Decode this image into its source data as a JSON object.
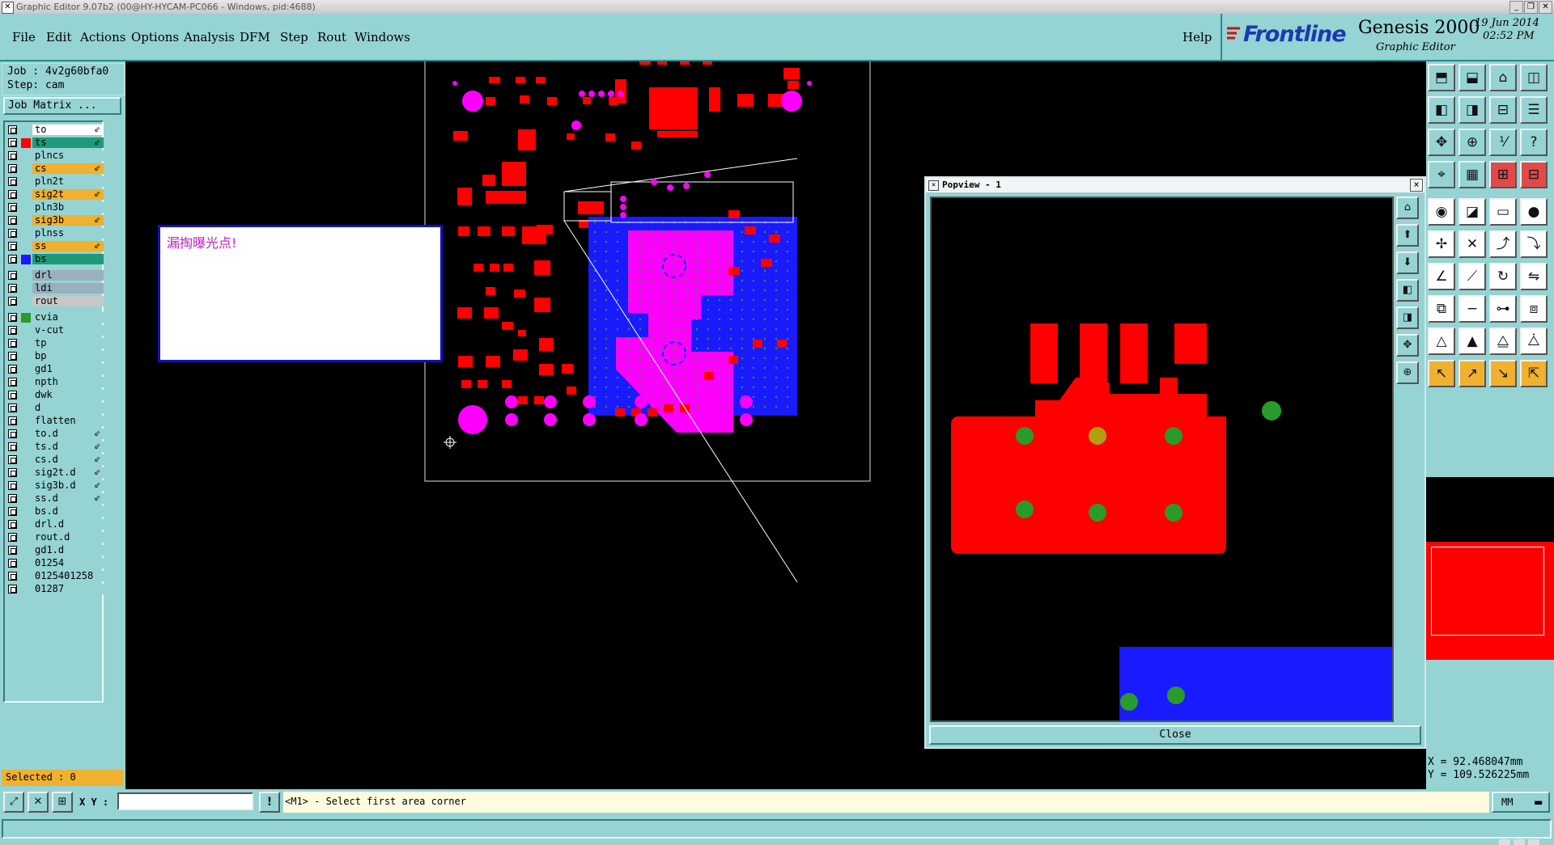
{
  "window": {
    "title": "Graphic Editor 9.07b2 (00@HY-HYCAM-PC066 - Windows, pid:4688)"
  },
  "menu": {
    "items": [
      "File",
      "Edit",
      "Actions",
      "Options",
      "Analysis",
      "DFM",
      "Step",
      "Rout",
      "Windows"
    ],
    "help": "Help"
  },
  "brand": {
    "logo": "Frontline",
    "product": "Genesis 2000",
    "subtitle": "Graphic Editor",
    "date": "19 Jun 2014",
    "time": "02:52 PM"
  },
  "job": {
    "job_line": "Job : 4v2g60bfa0",
    "step_line": "Step: cam",
    "matrix_button": "Job Matrix ..."
  },
  "layers": [
    {
      "name": "to",
      "bg": "#ffffff",
      "swatch": "",
      "mark": "⇙"
    },
    {
      "name": "ts",
      "bg": "#1e9a78",
      "swatch": "#ff0000",
      "mark": "⇙"
    },
    {
      "name": "plncs",
      "bg": "#96d3d3",
      "swatch": "",
      "mark": ""
    },
    {
      "name": "cs",
      "bg": "#f0b030",
      "swatch": "",
      "mark": "⇙"
    },
    {
      "name": "pln2t",
      "bg": "#96d3d3",
      "swatch": "",
      "mark": ""
    },
    {
      "name": "sig2t",
      "bg": "#f0b030",
      "swatch": "",
      "mark": "⇙"
    },
    {
      "name": "pln3b",
      "bg": "#96d3d3",
      "swatch": "",
      "mark": ""
    },
    {
      "name": "sig3b",
      "bg": "#f0b030",
      "swatch": "",
      "mark": "⇙"
    },
    {
      "name": "plnss",
      "bg": "#96d3d3",
      "swatch": "",
      "mark": ""
    },
    {
      "name": "ss",
      "bg": "#f0b030",
      "swatch": "",
      "mark": "⇙"
    },
    {
      "name": "bs",
      "bg": "#1e9a78",
      "swatch": "#1a1aff",
      "mark": ""
    },
    {
      "name": "drl",
      "bg": "#9ab0bc",
      "swatch": "",
      "mark": ""
    },
    {
      "name": "ldi",
      "bg": "#9ab0bc",
      "swatch": "",
      "mark": ""
    },
    {
      "name": "rout",
      "bg": "#c8c8c8",
      "swatch": "",
      "mark": ""
    },
    {
      "name": "cvia",
      "bg": "#96d3d3",
      "swatch": "#2a9a2a",
      "mark": ""
    },
    {
      "name": "v-cut",
      "bg": "#96d3d3",
      "swatch": "",
      "mark": ""
    },
    {
      "name": "tp",
      "bg": "#96d3d3",
      "swatch": "",
      "mark": ""
    },
    {
      "name": "bp",
      "bg": "#96d3d3",
      "swatch": "",
      "mark": ""
    },
    {
      "name": "gd1",
      "bg": "#96d3d3",
      "swatch": "",
      "mark": ""
    },
    {
      "name": "npth",
      "bg": "#96d3d3",
      "swatch": "",
      "mark": ""
    },
    {
      "name": "dwk",
      "bg": "#96d3d3",
      "swatch": "",
      "mark": ""
    },
    {
      "name": "d",
      "bg": "#96d3d3",
      "swatch": "",
      "mark": ""
    },
    {
      "name": "flatten",
      "bg": "#96d3d3",
      "swatch": "",
      "mark": ""
    },
    {
      "name": "to.d",
      "bg": "#96d3d3",
      "swatch": "",
      "mark": "⇙"
    },
    {
      "name": "ts.d",
      "bg": "#96d3d3",
      "swatch": "",
      "mark": "⇙"
    },
    {
      "name": "cs.d",
      "bg": "#96d3d3",
      "swatch": "",
      "mark": "⇙"
    },
    {
      "name": "sig2t.d",
      "bg": "#96d3d3",
      "swatch": "",
      "mark": "⇙"
    },
    {
      "name": "sig3b.d",
      "bg": "#96d3d3",
      "swatch": "",
      "mark": "⇙"
    },
    {
      "name": "ss.d",
      "bg": "#96d3d3",
      "swatch": "",
      "mark": "⇙"
    },
    {
      "name": "bs.d",
      "bg": "#96d3d3",
      "swatch": "",
      "mark": ""
    },
    {
      "name": "drl.d",
      "bg": "#96d3d3",
      "swatch": "",
      "mark": ""
    },
    {
      "name": "rout.d",
      "bg": "#96d3d3",
      "swatch": "",
      "mark": ""
    },
    {
      "name": "gd1.d",
      "bg": "#96d3d3",
      "swatch": "",
      "mark": ""
    },
    {
      "name": "01254",
      "bg": "#96d3d3",
      "swatch": "",
      "mark": ""
    },
    {
      "name": "0125401258",
      "bg": "#96d3d3",
      "swatch": "",
      "mark": ""
    },
    {
      "name": "01287",
      "bg": "#96d3d3",
      "swatch": "",
      "mark": ""
    }
  ],
  "selected": "Selected : 0",
  "message": "漏掏曝光点!",
  "popview": {
    "title": "Popview - 1",
    "close_label": "Close",
    "close_x": "×"
  },
  "coords": {
    "x_line": "X = 92.468047mm",
    "y_line": "Y = 109.526225mm"
  },
  "status": {
    "xy_label": "X Y :",
    "xy_value": "",
    "prompt": "<M1> - Select first area corner",
    "units": "MM"
  },
  "colors": {
    "panel": "#96d3d3",
    "copper_red": "#ff0000",
    "magenta": "#ff00ff",
    "blue": "#1a1aff",
    "via_green": "#2a9a2a"
  }
}
